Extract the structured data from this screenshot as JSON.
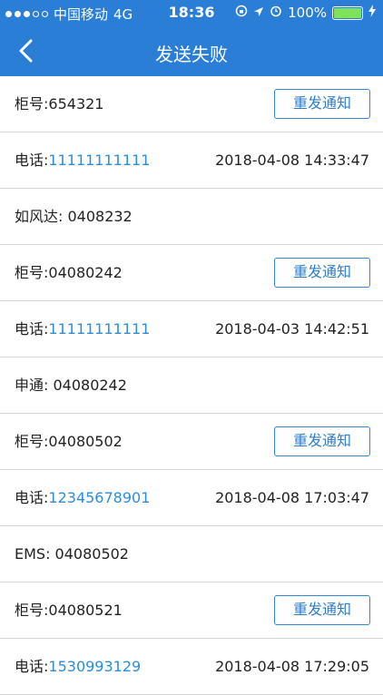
{
  "status_bar": {
    "carrier": "中国移动",
    "network": "4G",
    "time": "18:36",
    "battery": "100%"
  },
  "nav": {
    "title": "发送失败"
  },
  "records": [
    {
      "cabinet_label": "柜号:",
      "cabinet_no": "654321",
      "button": "重发通知",
      "phone_label": "电话:",
      "phone": "11111111111",
      "datetime": "2018-04-08 14:33:47",
      "courier": "如风达: 0408232"
    },
    {
      "cabinet_label": "柜号:",
      "cabinet_no": "04080242",
      "button": "重发通知",
      "phone_label": "电话:",
      "phone": "11111111111",
      "datetime": "2018-04-03 14:42:51",
      "courier": "申通: 04080242"
    },
    {
      "cabinet_label": "柜号:",
      "cabinet_no": "04080502",
      "button": "重发通知",
      "phone_label": "电话:",
      "phone": "12345678901",
      "datetime": "2018-04-08 17:03:47",
      "courier": "EMS: 04080502"
    },
    {
      "cabinet_label": "柜号:",
      "cabinet_no": "04080521",
      "button": "重发通知",
      "phone_label": "电话:",
      "phone": "1530993129",
      "datetime": "2018-04-08 17:29:05"
    }
  ],
  "colors": {
    "header": "#2a7ed6",
    "cabinet_text": "#36a0d9",
    "button_border": "#3386d4"
  }
}
